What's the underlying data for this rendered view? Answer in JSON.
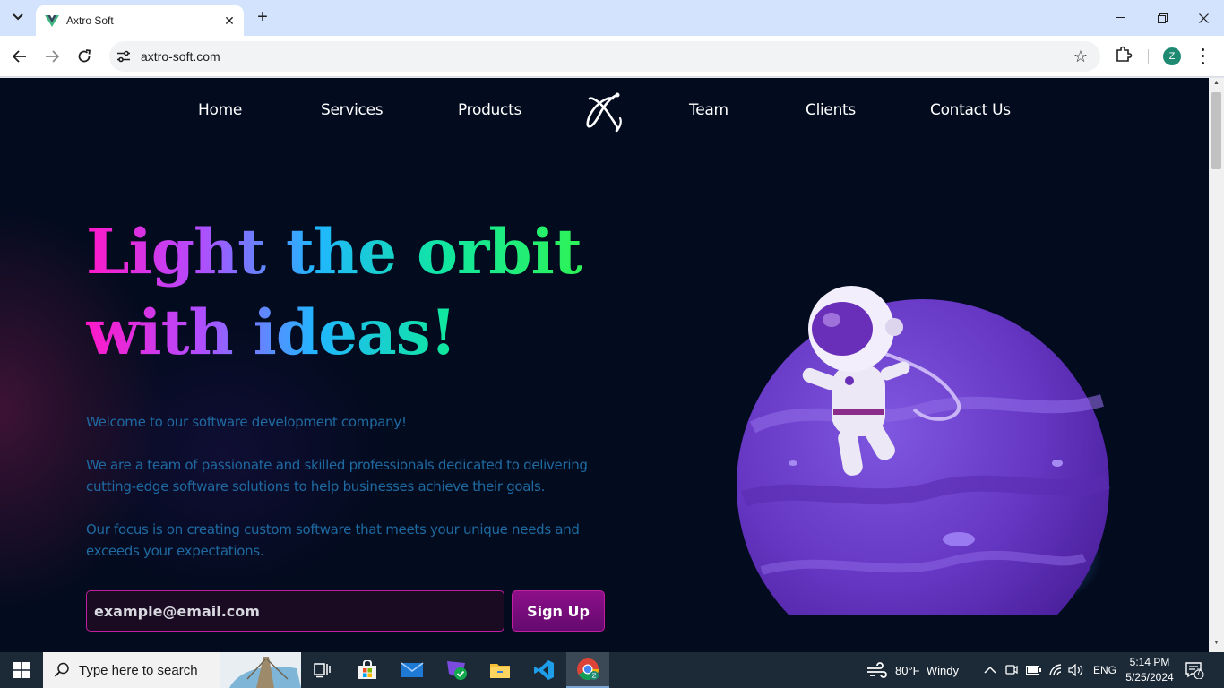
{
  "browser": {
    "tab_title": "Axtro Soft",
    "url": "axtro-soft.com",
    "profile_initial": "Z"
  },
  "site": {
    "nav": [
      "Home",
      "Services",
      "Products",
      "Team",
      "Clients",
      "Contact Us"
    ],
    "hero_title_line1": "Light the orbit",
    "hero_title_line2": "with ideas!",
    "paragraphs": [
      "Welcome to our software development company!",
      "We are a team of passionate and skilled professionals dedicated to delivering cutting-edge software solutions to help businesses achieve their goals.",
      "Our focus is on creating custom software that meets your unique needs and exceeds your expectations."
    ],
    "email_placeholder": "example@email.com",
    "signup_label": "Sign Up"
  },
  "colors": {
    "page_bg": "#030b1f",
    "gradient": [
      "#ff19c8",
      "#b04dff",
      "#21b6ff",
      "#10e6a2",
      "#2cf25a"
    ],
    "body_text": "#1e6aa1",
    "accent_border": "#c01fa0",
    "planet": "#6a3cc9"
  },
  "taskbar": {
    "search_placeholder": "Type here to search",
    "weather": "80°F  Windy",
    "language": "ENG",
    "time": "5:14 PM",
    "date": "5/25/2024",
    "notifications": "7",
    "apps": [
      "task-view-icon",
      "store-icon",
      "mail-icon",
      "app-icon",
      "file-explorer-icon",
      "vscode-icon",
      "chrome-icon"
    ]
  }
}
